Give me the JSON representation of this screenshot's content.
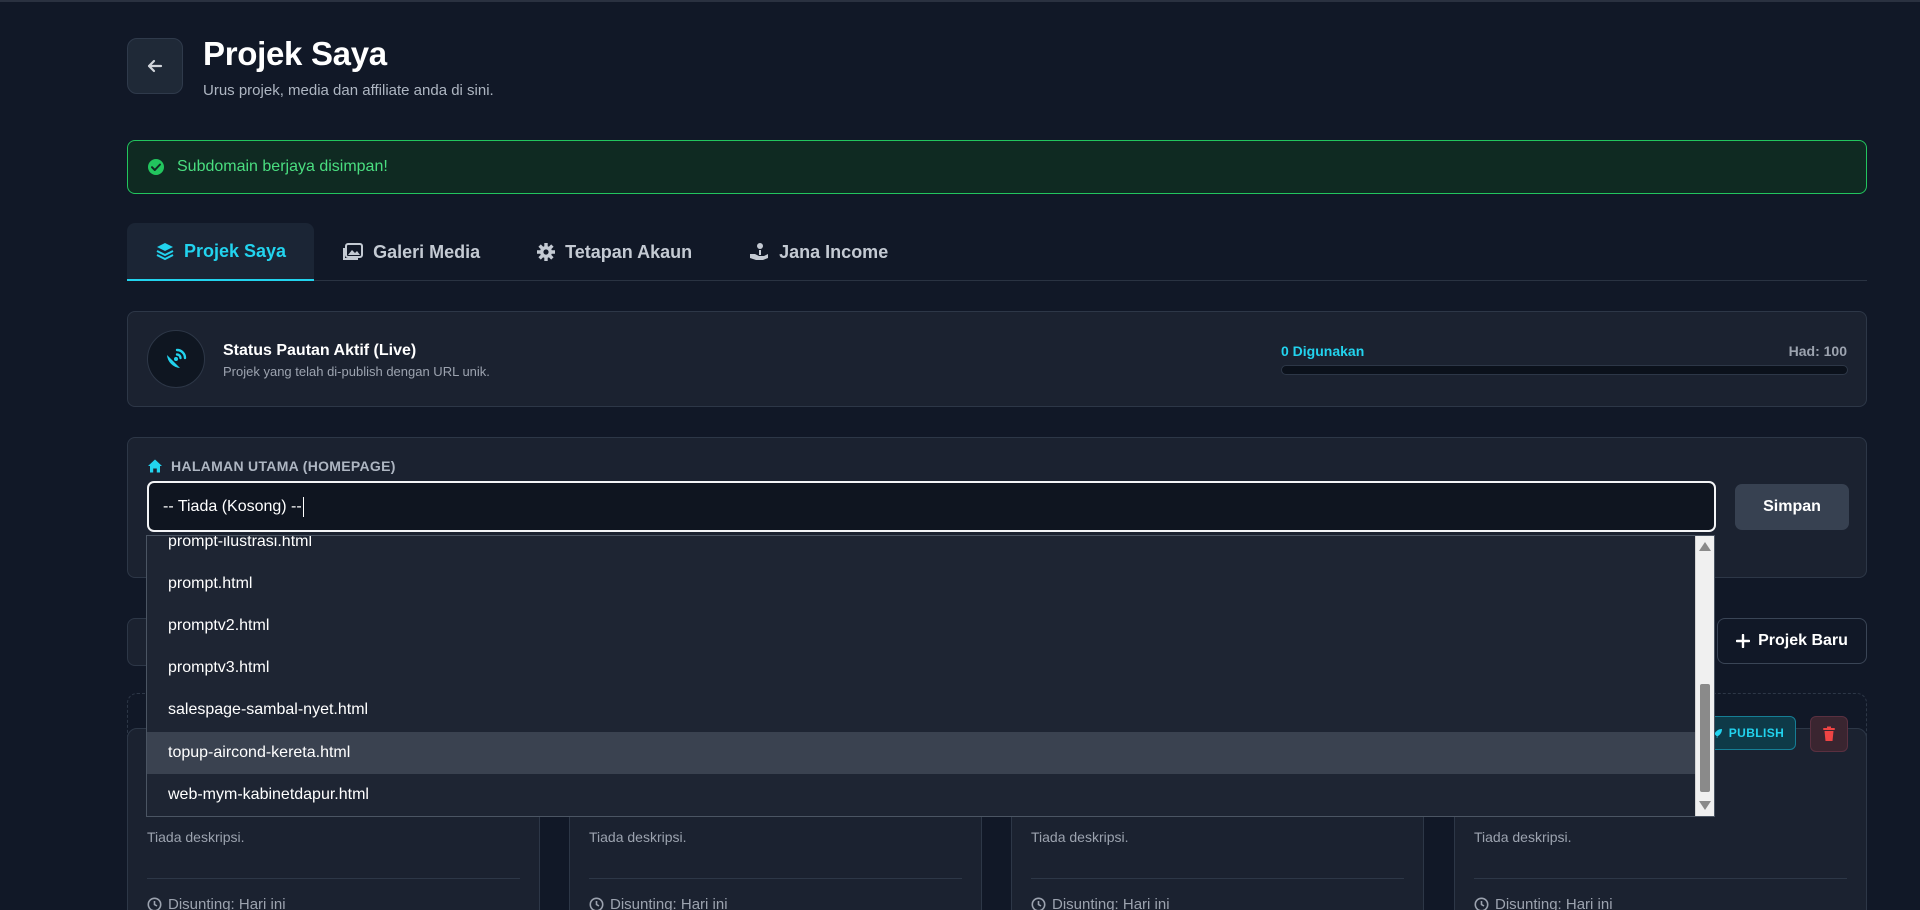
{
  "header": {
    "title": "Projek Saya",
    "subtitle": "Urus projek, media dan affiliate anda di sini."
  },
  "alert": {
    "message": "Subdomain berjaya disimpan!"
  },
  "tabs": [
    {
      "label": "Projek Saya",
      "icon": "layers-icon",
      "active": true
    },
    {
      "label": "Galeri Media",
      "icon": "images-icon",
      "active": false
    },
    {
      "label": "Tetapan Akaun",
      "icon": "gear-icon",
      "active": false
    },
    {
      "label": "Jana Income",
      "icon": "hand-coin-icon",
      "active": false
    }
  ],
  "status": {
    "title": "Status Pautan Aktif (Live)",
    "description": "Projek yang telah di-publish dengan URL unik.",
    "usage_label": "0 Digunakan",
    "limit_label": "Had: 100",
    "used": 0,
    "limit": 100
  },
  "homepage": {
    "label": "HALAMAN UTAMA (HOMEPAGE)",
    "selected_value": "-- Tiada (Kosong) --",
    "save_label": "Simpan",
    "options": [
      "prompt-ilustrasi.html",
      "prompt.html",
      "promptv2.html",
      "promptv3.html",
      "salespage-sambal-nyet.html",
      "topup-aircond-kereta.html",
      "web-mym-kabinetdapur.html"
    ],
    "highlighted_index": 5
  },
  "toolbar": {
    "new_project_label": "Projek Baru"
  },
  "project_cards": [
    {
      "description": "Tiada deskripsi.",
      "date": "Disunting: Hari ini"
    },
    {
      "description": "Tiada deskripsi.",
      "date": "Disunting: Hari ini"
    },
    {
      "description": "Tiada deskripsi.",
      "date": "Disunting: Hari ini"
    },
    {
      "description": "Tiada deskripsi.",
      "date": "Disunting: Hari ini",
      "publish_label": "PUBLISH"
    }
  ],
  "colors": {
    "background": "#111827",
    "accent": "#22d3ee",
    "success": "#22c55e",
    "danger": "#ef4444"
  }
}
